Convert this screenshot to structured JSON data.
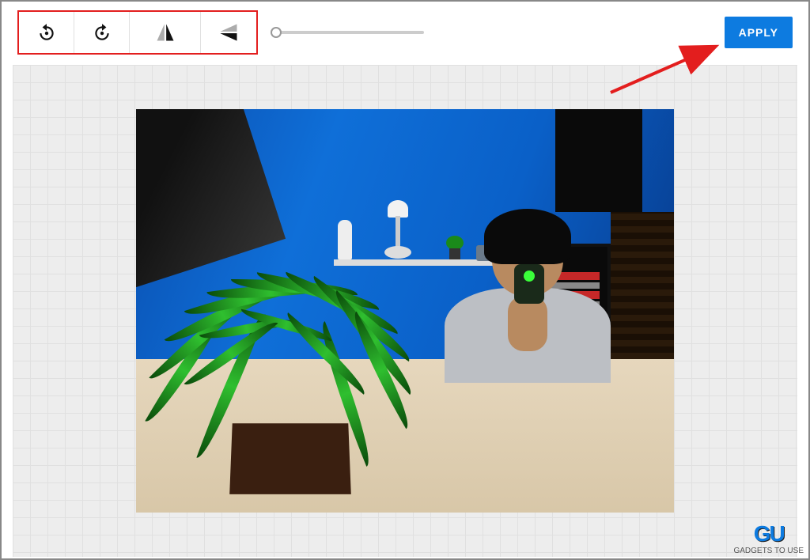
{
  "toolbar": {
    "rotate_ccw_icon": "rotate-ccw-icon",
    "rotate_cw_icon": "rotate-cw-icon",
    "flip_h_icon": "flip-horizontal-icon",
    "flip_v_icon": "flip-vertical-icon",
    "apply_label": "APPLY"
  },
  "annotation": {
    "highlight_color": "#e31e1e",
    "arrow_color": "#e31e1e"
  },
  "watermark": {
    "brand_short": "GU",
    "brand_tag": "GADGETS TO USE"
  }
}
